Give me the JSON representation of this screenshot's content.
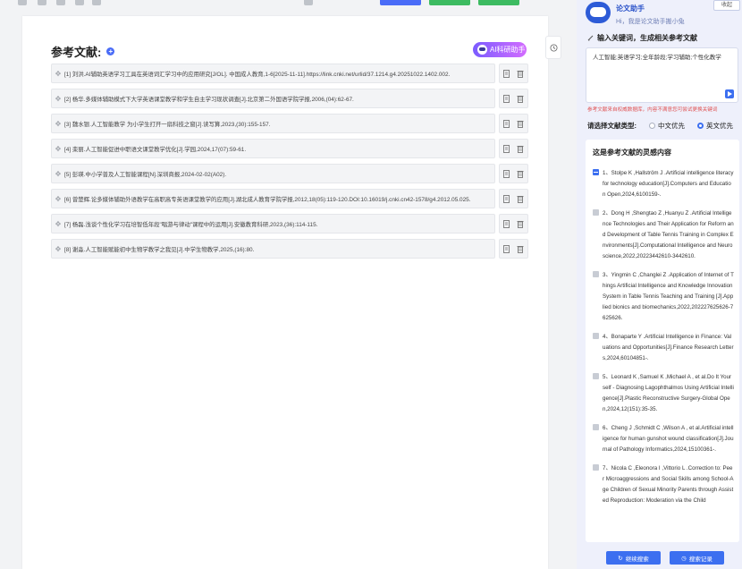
{
  "editor": {
    "section_title": "参考文献:",
    "add_label": "+",
    "ai_button_label": "AI科研助手",
    "references": [
      "[1] 刘洪.AI辅助英语学习工具在英语词汇学习中的应用研究[J/OL]. 中国成人教育,1-6[2025-11-11].https://link.cnki.net/urlid/37.1214.g4.20251022.1402.002.",
      "[2] 杨华.多媒体辅助模式下大学英语课堂教学和学生自主学习现状调查[J].北京第二外国语学院学报,2006,(04):62-67.",
      "[3] 魏水银.人工智能教学 为小学生打开一扇科技之窗[J].读写算,2023,(30):155-157.",
      "[4] 栾丽.人工智能促进中职语文课堂教学优化[J].学园,2024,17(07):59-61.",
      "[5] 彭瑛.中小学普及人工智能课程[N].深圳商报,2024-02-02(A02).",
      "[6] 曾楚辉.论多媒体辅助外语教学在高职高专英语课堂教学的应用[J].湖北成人教育学院学报,2012,18(05):119-120.DOI:10.16019/j.cnki.cn42-1578/g4.2012.05.025.",
      "[7] 杨磊.浅谈个性化学习在培智低年段\"唱游与律动\"课程中的运用[J].安徽教育科研,2023,(36):114-115.",
      "[8] 谢淼.人工智能赋能初中生物学教学之我见[J].中学生物教学,2025,(16):80."
    ]
  },
  "assistant": {
    "name": "论文助手",
    "greeting": "Hi，我是论文助手搬小兔",
    "collapse_label": "收起",
    "keyword_title": "输入关键词，生成相关参考文献",
    "keyword_value": "人工智能;英语学习;全年龄段;学习辅助;个性化教学",
    "keyword_note": "参考文献来自权威数据库，内容不满意您可尝试更换关键词",
    "type_label": "请选择文献类型:",
    "type_options": [
      "中文优先",
      "英文优先"
    ],
    "type_selected": "英文优先",
    "list_title": "这是参考文献的灵感内容",
    "literature": [
      {
        "checked": true,
        "text": "1、Stolpe K ,Hallström J .Artificial intelligence literacy for technology education[J].Computers and Education Open,2024,6100159-."
      },
      {
        "checked": false,
        "text": "2、Dong H ,Shengtao Z ,Huanyu Z .Artificial Intelligence Technologies and Their Application for Reform and Development of Table Tennis Training in Complex Environments[J].Computational Intelligence and Neuroscience,2022,20223442610-3442610."
      },
      {
        "checked": false,
        "text": "3、Yingmin C ,Changlei Z .Application of Internet of Things Artificial Intelligence and Knowledge Innovation System in Table Tennis Teaching and Training [J].Applied bionics and biomechanics,2022,202227625626-7625626."
      },
      {
        "checked": false,
        "text": "4、Bonaparte Y .Artificial Intelligence in Finance: Valuations and Opportunities[J].Finance Research Letters,2024,60104851-."
      },
      {
        "checked": false,
        "text": "5、Leonard K ,Samuel K ,Michael A , et al.Do It Yourself - Diagnosing Lagophthalmos Using Artificial Intelligence[J].Plastic Reconstructive Surgery-Global Open,2024,12(151):35-35."
      },
      {
        "checked": false,
        "text": "6、Cheng J ,Schmidt C ,Wilson A , et al.Artificial intelligence for human gunshot wound classification[J].Journal of Pathology Informatics,2024,15100361-."
      },
      {
        "checked": false,
        "text": "7、Nicola C ,Eleonora I ,Vittorio L .Correction to: Peer Microaggressions and Social Skills among School-Age Children of Sexual Minority Parents through Assisted Reproduction: Moderation via the Child"
      }
    ],
    "continue_label": "继续搜索",
    "history_label": "搜索记录"
  },
  "colors": {
    "accent": "#3c6ff0",
    "panel_bg": "#eef0fb",
    "note_red": "#e05050"
  }
}
